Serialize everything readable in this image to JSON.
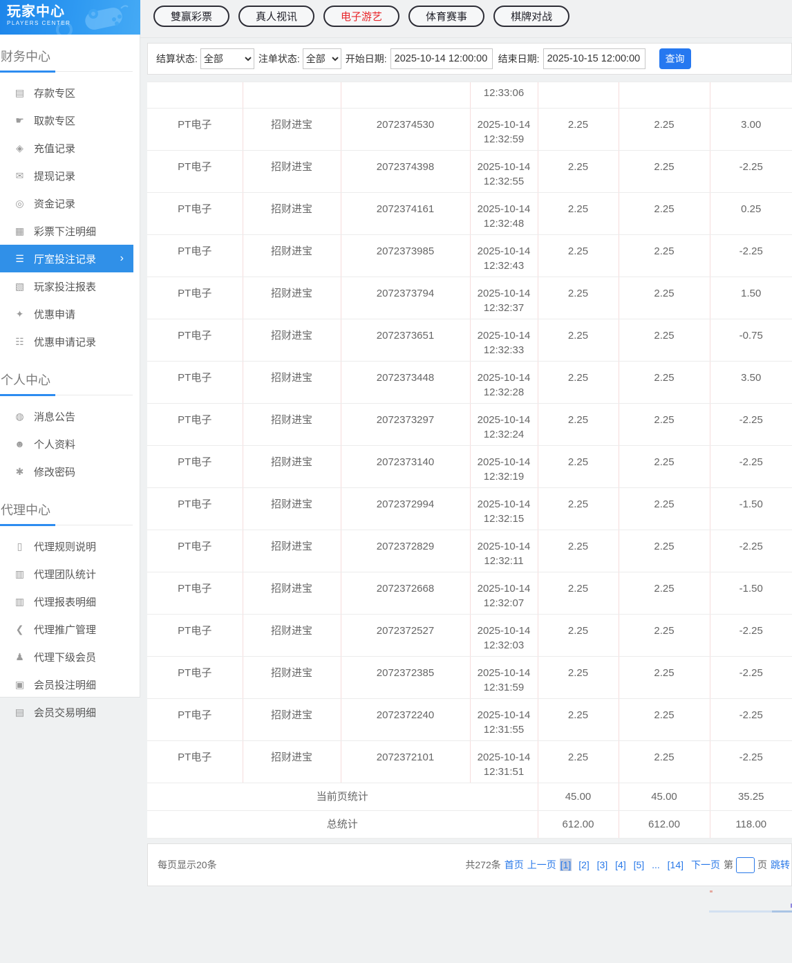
{
  "sidebar": {
    "title": "玩家中心",
    "subtitle": "PLAYERS CENTER",
    "sections": [
      {
        "title": "财务中心",
        "items": [
          {
            "label": "存款专区",
            "icon": "deposit-icon",
            "active": false
          },
          {
            "label": "取款专区",
            "icon": "withdraw-icon",
            "active": false
          },
          {
            "label": "充值记录",
            "icon": "recharge-record-icon",
            "active": false
          },
          {
            "label": "提现记录",
            "icon": "withdraw-record-icon",
            "active": false
          },
          {
            "label": "资金记录",
            "icon": "funds-record-icon",
            "active": false
          },
          {
            "label": "彩票下注明细",
            "icon": "lottery-bets-icon",
            "active": false
          },
          {
            "label": "厅室投注记录",
            "icon": "hall-bets-icon",
            "active": true
          },
          {
            "label": "玩家投注报表",
            "icon": "player-report-icon",
            "active": false
          },
          {
            "label": "优惠申请",
            "icon": "promo-apply-icon",
            "active": false
          },
          {
            "label": "优惠申请记录",
            "icon": "promo-record-icon",
            "active": false
          }
        ]
      },
      {
        "title": "个人中心",
        "items": [
          {
            "label": "消息公告",
            "icon": "bell-icon",
            "active": false
          },
          {
            "label": "个人资料",
            "icon": "person-icon",
            "active": false
          },
          {
            "label": "修改密码",
            "icon": "gear-icon",
            "active": false
          }
        ]
      },
      {
        "title": "代理中心",
        "items": [
          {
            "label": "代理规则说明",
            "icon": "doc-icon",
            "active": false
          },
          {
            "label": "代理团队统计",
            "icon": "team-stats-icon",
            "active": false
          },
          {
            "label": "代理报表明细",
            "icon": "report-detail-icon",
            "active": false
          },
          {
            "label": "代理推广管理",
            "icon": "share-icon",
            "active": false
          },
          {
            "label": "代理下级会员",
            "icon": "members-icon",
            "active": false
          },
          {
            "label": "会员投注明细",
            "icon": "member-bets-icon",
            "active": false
          },
          {
            "label": "会员交易明细",
            "icon": "member-trans-icon",
            "active": false
          }
        ]
      }
    ]
  },
  "icon_glyphs": {
    "deposit-icon": "▤",
    "withdraw-icon": "☛",
    "recharge-record-icon": "◈",
    "withdraw-record-icon": "✉",
    "funds-record-icon": "◎",
    "lottery-bets-icon": "▦",
    "hall-bets-icon": "☰",
    "player-report-icon": "▧",
    "promo-apply-icon": "✦",
    "promo-record-icon": "☷",
    "bell-icon": "◍",
    "person-icon": "☻",
    "gear-icon": "✱",
    "doc-icon": "▯",
    "team-stats-icon": "▥",
    "report-detail-icon": "▥",
    "share-icon": "❮",
    "members-icon": "♟",
    "member-bets-icon": "▣",
    "member-trans-icon": "▤"
  },
  "ui": {
    "chevron_right": "›"
  },
  "tabs": [
    {
      "label": "雙赢彩票",
      "active": false
    },
    {
      "label": "真人视讯",
      "active": false
    },
    {
      "label": "电子游艺",
      "active": true
    },
    {
      "label": "体育赛事",
      "active": false
    },
    {
      "label": "棋牌对战",
      "active": false
    }
  ],
  "filters": {
    "settle_status_label": "结算状态:",
    "settle_status_value": "全部",
    "order_status_label": "注单状态:",
    "order_status_value": "全部",
    "start_date_label": "开始日期:",
    "start_date_value": "2025-10-14 12:00:00",
    "end_date_label": "结束日期:",
    "end_date_value": "2025-10-15 12:00:00",
    "search_label": "查询"
  },
  "table": {
    "partial_row_time": "12:33:06",
    "rows": [
      {
        "platform": "PT电子",
        "game": "招财进宝",
        "order": "2072374530",
        "date": "2025-10-14",
        "time": "12:32:59",
        "bet": "2.25",
        "valid": "2.25",
        "profit": "3.00"
      },
      {
        "platform": "PT电子",
        "game": "招财进宝",
        "order": "2072374398",
        "date": "2025-10-14",
        "time": "12:32:55",
        "bet": "2.25",
        "valid": "2.25",
        "profit": "-2.25"
      },
      {
        "platform": "PT电子",
        "game": "招财进宝",
        "order": "2072374161",
        "date": "2025-10-14",
        "time": "12:32:48",
        "bet": "2.25",
        "valid": "2.25",
        "profit": "0.25"
      },
      {
        "platform": "PT电子",
        "game": "招财进宝",
        "order": "2072373985",
        "date": "2025-10-14",
        "time": "12:32:43",
        "bet": "2.25",
        "valid": "2.25",
        "profit": "-2.25"
      },
      {
        "platform": "PT电子",
        "game": "招财进宝",
        "order": "2072373794",
        "date": "2025-10-14",
        "time": "12:32:37",
        "bet": "2.25",
        "valid": "2.25",
        "profit": "1.50"
      },
      {
        "platform": "PT电子",
        "game": "招财进宝",
        "order": "2072373651",
        "date": "2025-10-14",
        "time": "12:32:33",
        "bet": "2.25",
        "valid": "2.25",
        "profit": "-0.75"
      },
      {
        "platform": "PT电子",
        "game": "招财进宝",
        "order": "2072373448",
        "date": "2025-10-14",
        "time": "12:32:28",
        "bet": "2.25",
        "valid": "2.25",
        "profit": "3.50"
      },
      {
        "platform": "PT电子",
        "game": "招财进宝",
        "order": "2072373297",
        "date": "2025-10-14",
        "time": "12:32:24",
        "bet": "2.25",
        "valid": "2.25",
        "profit": "-2.25"
      },
      {
        "platform": "PT电子",
        "game": "招财进宝",
        "order": "2072373140",
        "date": "2025-10-14",
        "time": "12:32:19",
        "bet": "2.25",
        "valid": "2.25",
        "profit": "-2.25"
      },
      {
        "platform": "PT电子",
        "game": "招财进宝",
        "order": "2072372994",
        "date": "2025-10-14",
        "time": "12:32:15",
        "bet": "2.25",
        "valid": "2.25",
        "profit": "-1.50"
      },
      {
        "platform": "PT电子",
        "game": "招财进宝",
        "order": "2072372829",
        "date": "2025-10-14",
        "time": "12:32:11",
        "bet": "2.25",
        "valid": "2.25",
        "profit": "-2.25"
      },
      {
        "platform": "PT电子",
        "game": "招财进宝",
        "order": "2072372668",
        "date": "2025-10-14",
        "time": "12:32:07",
        "bet": "2.25",
        "valid": "2.25",
        "profit": "-1.50"
      },
      {
        "platform": "PT电子",
        "game": "招财进宝",
        "order": "2072372527",
        "date": "2025-10-14",
        "time": "12:32:03",
        "bet": "2.25",
        "valid": "2.25",
        "profit": "-2.25"
      },
      {
        "platform": "PT电子",
        "game": "招财进宝",
        "order": "2072372385",
        "date": "2025-10-14",
        "time": "12:31:59",
        "bet": "2.25",
        "valid": "2.25",
        "profit": "-2.25"
      },
      {
        "platform": "PT电子",
        "game": "招财进宝",
        "order": "2072372240",
        "date": "2025-10-14",
        "time": "12:31:55",
        "bet": "2.25",
        "valid": "2.25",
        "profit": "-2.25"
      },
      {
        "platform": "PT电子",
        "game": "招财进宝",
        "order": "2072372101",
        "date": "2025-10-14",
        "time": "12:31:51",
        "bet": "2.25",
        "valid": "2.25",
        "profit": "-2.25"
      }
    ],
    "summary": [
      {
        "label": "当前页统计",
        "bet": "45.00",
        "valid": "45.00",
        "profit": "35.25"
      },
      {
        "label": "总统计",
        "bet": "612.00",
        "valid": "612.00",
        "profit": "118.00"
      }
    ]
  },
  "pagination": {
    "per_page": "每页显示20条",
    "total": "共272条",
    "first": "首页",
    "prev": "上一页",
    "pages": [
      "[1]",
      "[2]",
      "[3]",
      "[4]",
      "[5]",
      "...",
      "[14]"
    ],
    "current_page": "[1]",
    "next": "下一页",
    "jump_pre": "第",
    "jump_value": "",
    "jump_post": "页",
    "jump_label": "跳转"
  },
  "colors": {
    "accent_blue": "#2678f0",
    "link_blue": "#2878e8",
    "sidebar_active_blue": "#3090e8",
    "header_gradient_start": "#1d85ea",
    "header_gradient_end": "#45aaf5",
    "active_tab_red": "#e8252a",
    "table_vline_pink": "#f5dcdc"
  }
}
